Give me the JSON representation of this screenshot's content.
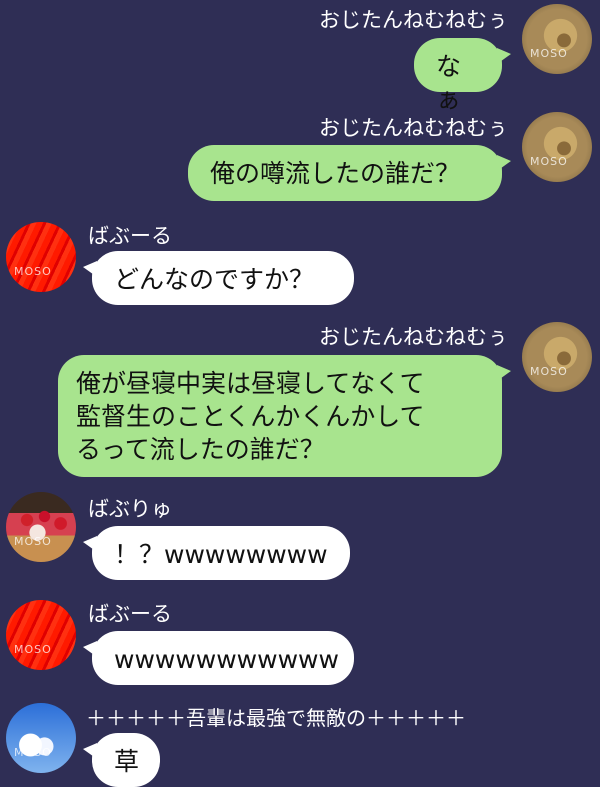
{
  "messages": [
    {
      "sender": "おじたんねむねむぅ",
      "text": "なぁ",
      "avatar": "lion-avatar",
      "watermark": "MOSO"
    },
    {
      "sender": "おじたんねむねむぅ",
      "text": "俺の噂流したの誰だ？",
      "avatar": "lion-avatar",
      "watermark": "MOSO"
    },
    {
      "sender": "ばぶーる",
      "text": "どんなのですか？",
      "avatar": "red-avatar",
      "watermark": "MOSO"
    },
    {
      "sender": "おじたんねむねむぅ",
      "text": "俺が昼寝中実は昼寝してなくて\n監督生のことくんかくんかして\nるって流したの誰だ？",
      "avatar": "lion-avatar",
      "watermark": "MOSO"
    },
    {
      "sender": "ばぶりゅ",
      "text": "！？wwwwwwww",
      "avatar": "cake-avatar",
      "watermark": "MOSO"
    },
    {
      "sender": "ばぶーる",
      "text": "wwwwwwwwwww",
      "avatar": "red-avatar",
      "watermark": "MOSO"
    },
    {
      "sender": "＋＋＋＋＋吾輩は最強で無敵の＋＋＋＋＋",
      "text": "草",
      "avatar": "sky-avatar",
      "watermark": "MOSO"
    }
  ],
  "colors": {
    "background": "#2f2e55",
    "own_bubble": "#a8e48e",
    "other_bubble": "#ffffff",
    "sender_text": "#ffffff"
  }
}
